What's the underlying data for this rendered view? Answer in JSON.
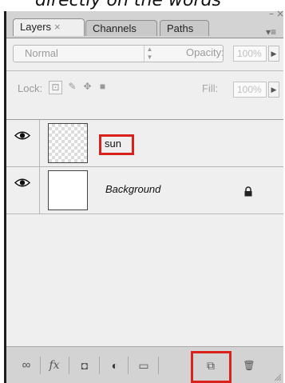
{
  "caption": {
    "text": "directly on the words"
  },
  "window_controls": {
    "minimize": "–",
    "close": "×"
  },
  "tabs": [
    {
      "label": "Layers",
      "close": "×",
      "active": true
    },
    {
      "label": "Channels",
      "active": false
    },
    {
      "label": "Paths",
      "active": false
    }
  ],
  "panel_menu": {
    "icon": "panel-menu-icon",
    "glyph": "▾≡"
  },
  "blend": {
    "mode": "Normal",
    "opacity_label": "Opacity:",
    "opacity_value": "100%"
  },
  "lock": {
    "label": "Lock:",
    "fill_label": "Fill:",
    "fill_value": "100%"
  },
  "layers": [
    {
      "name": "sun",
      "visible": true,
      "thumbnail": "transparent",
      "highlighted": true,
      "locked": false
    },
    {
      "name": "Background",
      "visible": true,
      "thumbnail": "white",
      "highlighted": false,
      "locked": true
    }
  ],
  "bottom_bar": {
    "buttons": [
      {
        "icon": "link-layers-icon",
        "glyph": "∞"
      },
      {
        "icon": "layer-style-fx-icon",
        "glyph": "fx"
      },
      {
        "icon": "layer-mask-icon",
        "glyph": "◘"
      },
      {
        "icon": "adjustment-layer-icon",
        "glyph": "◐"
      },
      {
        "icon": "new-group-folder-icon",
        "glyph": "▭"
      },
      {
        "icon": "new-layer-icon",
        "glyph": "⧉",
        "highlighted": true
      },
      {
        "icon": "trash-icon",
        "glyph": "🗑"
      }
    ]
  },
  "colors": {
    "highlight": "#d9221c",
    "panel": "#d3d3d3",
    "content": "#efefef"
  }
}
